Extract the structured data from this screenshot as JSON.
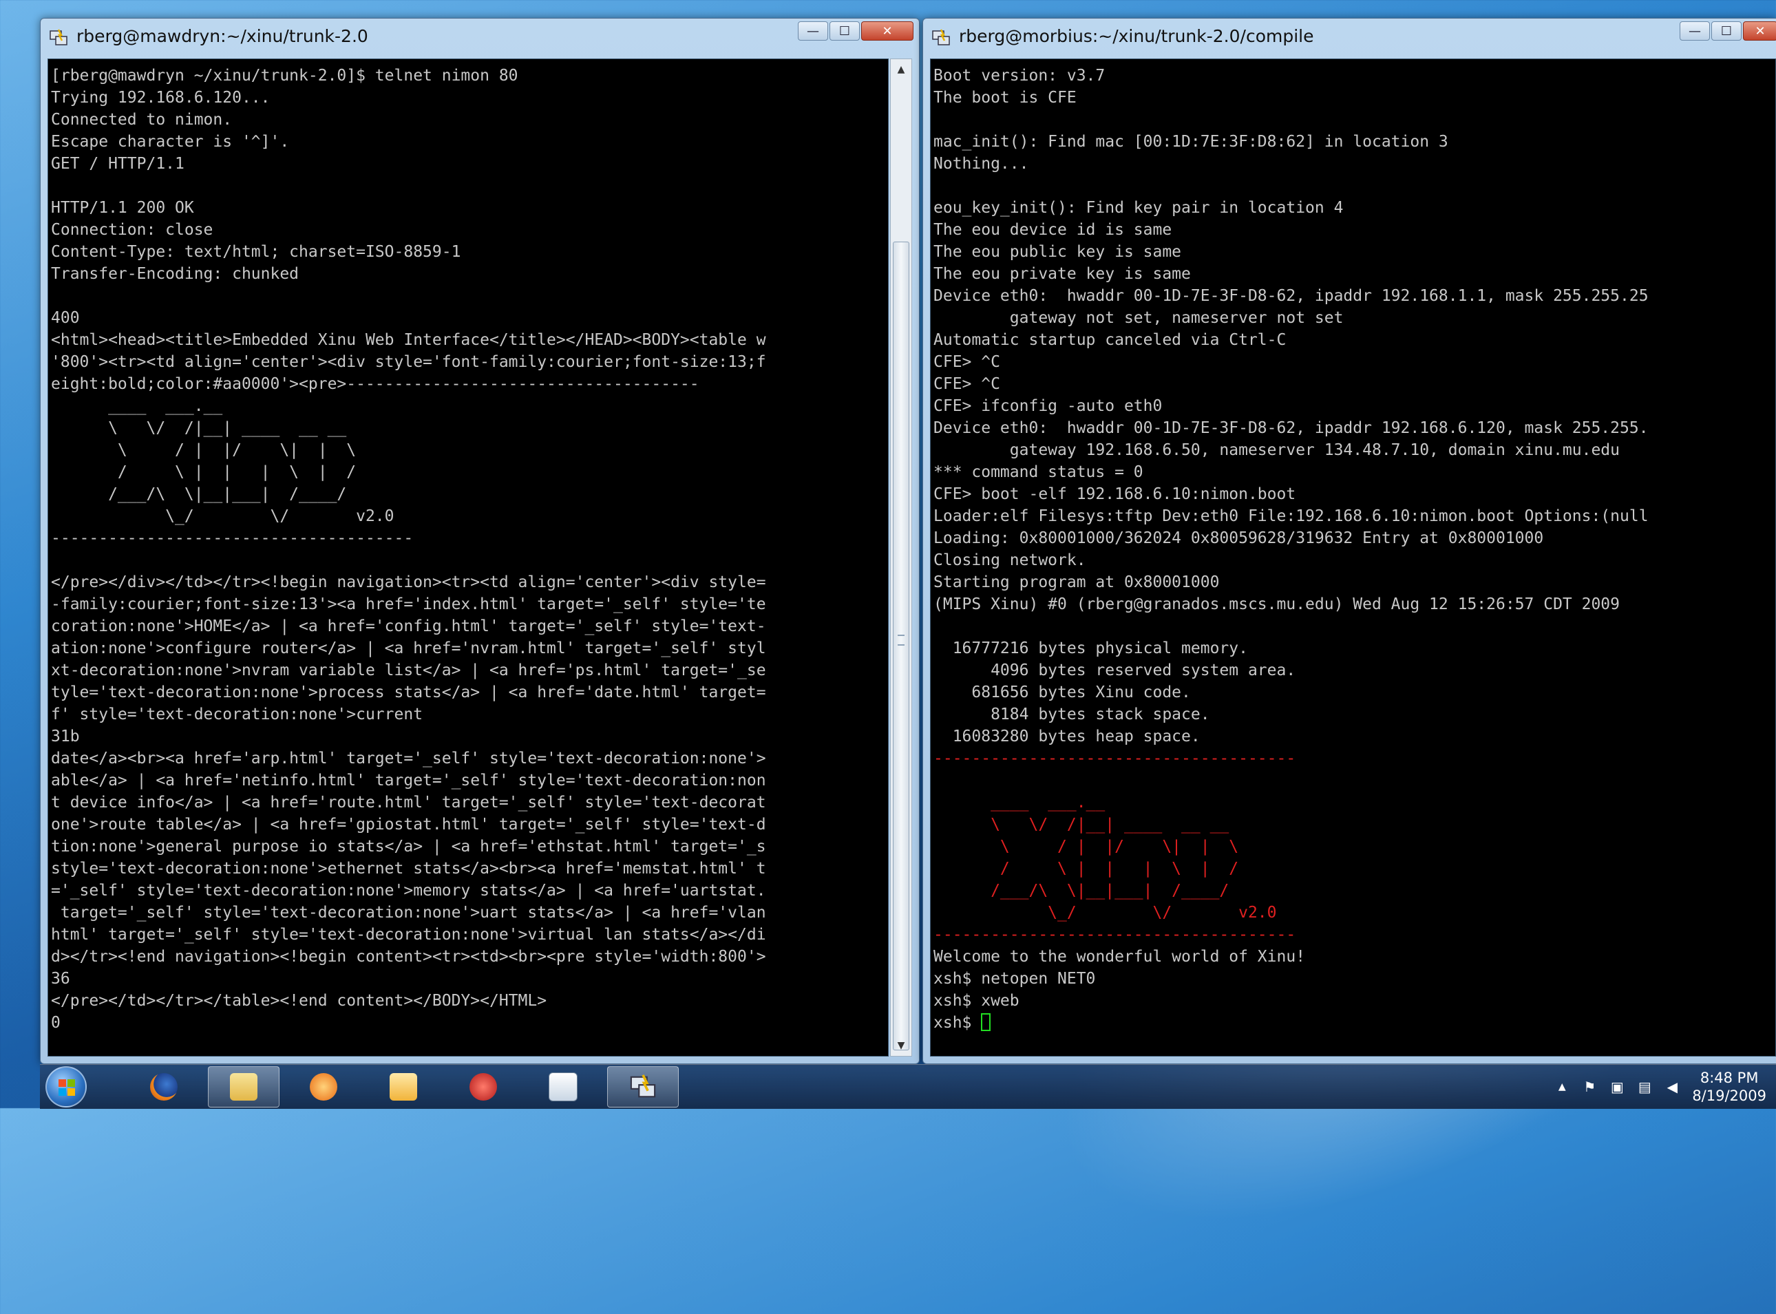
{
  "left_window": {
    "title": "rberg@mawdryn:~/xinu/trunk-2.0",
    "terminal_text": "[rberg@mawdryn ~/xinu/trunk-2.0]$ telnet nimon 80\nTrying 192.168.6.120...\nConnected to nimon.\nEscape character is '^]'.\nGET / HTTP/1.1\n\nHTTP/1.1 200 OK\nConnection: close\nContent-Type: text/html; charset=ISO-8859-1\nTransfer-Encoding: chunked\n\n400\n<html><head><title>Embedded Xinu Web Interface</title></HEAD><BODY><table w\n'800'><tr><td align='center'><div style='font-family:courier;font-size:13;f\neight:bold;color:#aa0000'><pre>-------------------------------------\n      ____  ___.__\n      \\   \\/  /|__| ____  __ __\n       \\     / |  |/    \\|  |  \\\n       /     \\ |  |   |  \\  |  /\n      /___/\\  \\|__|___|  /____/\n            \\_/        \\/       v2.0\n--------------------------------------\n\n</pre></div></td></tr><!begin navigation><tr><td align='center'><div style=\n-family:courier;font-size:13'><a href='index.html' target='_self' style='te\ncoration:none'>HOME</a> | <a href='config.html' target='_self' style='text-\nation:none'>configure router</a> | <a href='nvram.html' target='_self' styl\nxt-decoration:none'>nvram variable list</a> | <a href='ps.html' target='_se\ntyle='text-decoration:none'>process stats</a> | <a href='date.html' target=\nf' style='text-decoration:none'>current\n31b\ndate</a><br><a href='arp.html' target='_self' style='text-decoration:none'>\nable</a> | <a href='netinfo.html' target='_self' style='text-decoration:non\nt device info</a> | <a href='route.html' target='_self' style='text-decorat\none'>route table</a> | <a href='gpiostat.html' target='_self' style='text-d\ntion:none'>general purpose io stats</a> | <a href='ethstat.html' target='_s\nstyle='text-decoration:none'>ethernet stats</a><br><a href='memstat.html' t\n='_self' style='text-decoration:none'>memory stats</a> | <a href='uartstat.\n target='_self' style='text-decoration:none'>uart stats</a> | <a href='vlan\nhtml' target='_self' style='text-decoration:none'>virtual lan stats</a></di\nd></tr><!end navigation><!begin content><tr><td><br><pre style='width:800'>\n36\n</pre></td></tr></table><!end content></BODY></HTML>\n0"
  },
  "right_window": {
    "title": "rberg@morbius:~/xinu/trunk-2.0/compile",
    "boot_text": "Boot version: v3.7\nThe boot is CFE\n\nmac_init(): Find mac [00:1D:7E:3F:D8:62] in location 3\nNothing...\n\neou_key_init(): Find key pair in location 4\nThe eou device id is same\nThe eou public key is same\nThe eou private key is same\nDevice eth0:  hwaddr 00-1D-7E-3F-D8-62, ipaddr 192.168.1.1, mask 255.255.25\n        gateway not set, nameserver not set\nAutomatic startup canceled via Ctrl-C\nCFE> ^C\nCFE> ^C\nCFE> ifconfig -auto eth0\nDevice eth0:  hwaddr 00-1D-7E-3F-D8-62, ipaddr 192.168.6.120, mask 255.255.\n        gateway 192.168.6.50, nameserver 134.48.7.10, domain xinu.mu.edu\n*** command status = 0\nCFE> boot -elf 192.168.6.10:nimon.boot\nLoader:elf Filesys:tftp Dev:eth0 File:192.168.6.10:nimon.boot Options:(null\nLoading: 0x80001000/362024 0x80059628/319632 Entry at 0x80001000\nClosing network.\nStarting program at 0x80001000\n(MIPS Xinu) #0 (rberg@granados.mscs.mu.edu) Wed Aug 12 15:26:57 CDT 2009\n\n  16777216 bytes physical memory.\n      4096 bytes reserved system area.\n    681656 bytes Xinu code.\n      8184 bytes stack space.\n  16083280 bytes heap space.\n",
    "banner_text": "--------------------------------------\n\n      ____  ___.__\n      \\   \\/  /|__| ____  __ __\n       \\     / |  |/    \\|  |  \\\n       /     \\ |  |   |  \\  |  /\n      /___/\\  \\|__|___|  /____/\n            \\_/        \\/       v2.0\n--------------------------------------",
    "shell_text": "\nWelcome to the wonderful world of Xinu!\nxsh$ netopen NET0\nxsh$ xweb\n",
    "prompt": "xsh$ "
  },
  "window_controls": {
    "minimize": "—",
    "maximize": "☐",
    "close": "✕"
  },
  "taskbar": {
    "clock_time": "8:48 PM",
    "clock_date": "8/19/2009",
    "tray_up_arrow": "▲"
  },
  "colors": {
    "terminal_bg": "#000000",
    "terminal_fg": "#c8c8c8",
    "banner_red": "#e02020",
    "cursor_green": "#22dd22"
  }
}
